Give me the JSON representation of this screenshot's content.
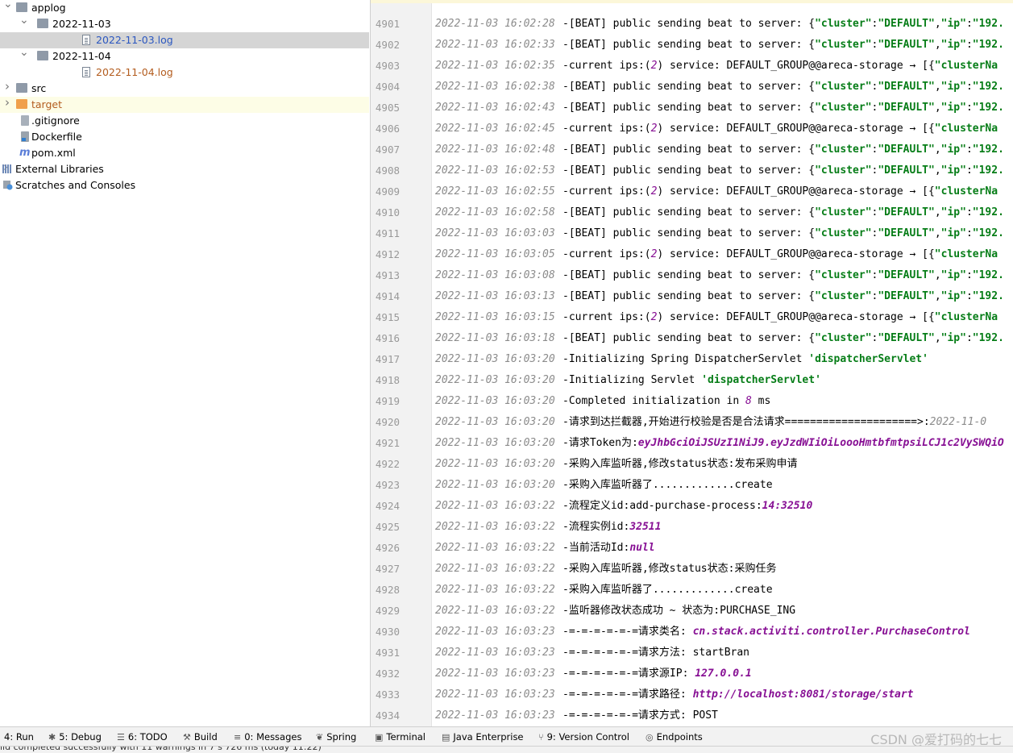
{
  "tree": [
    {
      "label": "applog",
      "icon": "folder-icon",
      "indent": 0,
      "arrow": "down",
      "style": ""
    },
    {
      "label": "2022-11-03",
      "icon": "folder-icon",
      "indent": 1,
      "arrow": "down",
      "style": ""
    },
    {
      "label": "2022-11-03.log",
      "icon": "log-file-icon",
      "indent": 2,
      "arrow": "",
      "style": "sel",
      "color": "#2b57c0"
    },
    {
      "label": "2022-11-04",
      "icon": "folder-icon",
      "indent": 1,
      "arrow": "down",
      "style": ""
    },
    {
      "label": "2022-11-04.log",
      "icon": "log-file-icon",
      "indent": 2,
      "arrow": "",
      "style": "",
      "color": "#b35c1e"
    },
    {
      "label": "src",
      "icon": "folder-icon",
      "indent": 0,
      "arrow": "right",
      "style": ""
    },
    {
      "label": "target",
      "icon": "folder-orange-icon",
      "indent": 0,
      "arrow": "right",
      "style": "hl",
      "color": "#b35c1e"
    },
    {
      "label": ".gitignore",
      "icon": "gitignore-file-icon",
      "indent": 0,
      "arrow": "",
      "style": ""
    },
    {
      "label": "Dockerfile",
      "icon": "docker-file-icon",
      "indent": 0,
      "arrow": "",
      "style": ""
    },
    {
      "label": "pom.xml",
      "icon": "maven-file-icon",
      "indent": 0,
      "arrow": "",
      "style": ""
    },
    {
      "label": "External Libraries",
      "icon": "libraries-icon",
      "indent": -1,
      "arrow": "right",
      "style": ""
    },
    {
      "label": "Scratches and Consoles",
      "icon": "scratches-icon",
      "indent": -1,
      "arrow": "",
      "style": ""
    }
  ],
  "log_lines": [
    {
      "n": "4901",
      "ts": "2022-11-03 16:02:28",
      "parts": [
        [
          "-",
          ""
        ],
        [
          "[BEAT] public sending beat to server: {",
          ""
        ],
        [
          "\"cluster\"",
          "s"
        ],
        [
          ":",
          ""
        ],
        [
          "\"DEFAULT\"",
          "s"
        ],
        [
          ",",
          ""
        ],
        [
          "\"ip\"",
          "s"
        ],
        [
          ":",
          ""
        ],
        [
          "\"192.",
          "s"
        ]
      ]
    },
    {
      "n": "4902",
      "ts": "2022-11-03 16:02:33",
      "parts": [
        [
          "-",
          ""
        ],
        [
          "[BEAT] public sending beat to server: {",
          ""
        ],
        [
          "\"cluster\"",
          "s"
        ],
        [
          ":",
          ""
        ],
        [
          "\"DEFAULT\"",
          "s"
        ],
        [
          ",",
          ""
        ],
        [
          "\"ip\"",
          "s"
        ],
        [
          ":",
          ""
        ],
        [
          "\"192.",
          "s"
        ]
      ]
    },
    {
      "n": "4903",
      "ts": "2022-11-03 16:02:35",
      "parts": [
        [
          "-current ips:(",
          ""
        ],
        [
          "2",
          "n"
        ],
        [
          ") service: DEFAULT_GROUP@@areca-storage → [{",
          ""
        ],
        [
          "\"clusterNa",
          "s"
        ]
      ]
    },
    {
      "n": "4904",
      "ts": "2022-11-03 16:02:38",
      "parts": [
        [
          "-",
          ""
        ],
        [
          "[BEAT] public sending beat to server: {",
          ""
        ],
        [
          "\"cluster\"",
          "s"
        ],
        [
          ":",
          ""
        ],
        [
          "\"DEFAULT\"",
          "s"
        ],
        [
          ",",
          ""
        ],
        [
          "\"ip\"",
          "s"
        ],
        [
          ":",
          ""
        ],
        [
          "\"192.",
          "s"
        ]
      ]
    },
    {
      "n": "4905",
      "ts": "2022-11-03 16:02:43",
      "parts": [
        [
          "-",
          ""
        ],
        [
          "[BEAT] public sending beat to server: {",
          ""
        ],
        [
          "\"cluster\"",
          "s"
        ],
        [
          ":",
          ""
        ],
        [
          "\"DEFAULT\"",
          "s"
        ],
        [
          ",",
          ""
        ],
        [
          "\"ip\"",
          "s"
        ],
        [
          ":",
          ""
        ],
        [
          "\"192.",
          "s"
        ]
      ]
    },
    {
      "n": "4906",
      "ts": "2022-11-03 16:02:45",
      "parts": [
        [
          "-current ips:(",
          ""
        ],
        [
          "2",
          "n"
        ],
        [
          ") service: DEFAULT_GROUP@@areca-storage → [{",
          ""
        ],
        [
          "\"clusterNa",
          "s"
        ]
      ]
    },
    {
      "n": "4907",
      "ts": "2022-11-03 16:02:48",
      "parts": [
        [
          "-",
          ""
        ],
        [
          "[BEAT] public sending beat to server: {",
          ""
        ],
        [
          "\"cluster\"",
          "s"
        ],
        [
          ":",
          ""
        ],
        [
          "\"DEFAULT\"",
          "s"
        ],
        [
          ",",
          ""
        ],
        [
          "\"ip\"",
          "s"
        ],
        [
          ":",
          ""
        ],
        [
          "\"192.",
          "s"
        ]
      ]
    },
    {
      "n": "4908",
      "ts": "2022-11-03 16:02:53",
      "parts": [
        [
          "-",
          ""
        ],
        [
          "[BEAT] public sending beat to server: {",
          ""
        ],
        [
          "\"cluster\"",
          "s"
        ],
        [
          ":",
          ""
        ],
        [
          "\"DEFAULT\"",
          "s"
        ],
        [
          ",",
          ""
        ],
        [
          "\"ip\"",
          "s"
        ],
        [
          ":",
          ""
        ],
        [
          "\"192.",
          "s"
        ]
      ]
    },
    {
      "n": "4909",
      "ts": "2022-11-03 16:02:55",
      "parts": [
        [
          "-current ips:(",
          ""
        ],
        [
          "2",
          "n"
        ],
        [
          ") service: DEFAULT_GROUP@@areca-storage → [{",
          ""
        ],
        [
          "\"clusterNa",
          "s"
        ]
      ]
    },
    {
      "n": "4910",
      "ts": "2022-11-03 16:02:58",
      "parts": [
        [
          "-",
          ""
        ],
        [
          "[BEAT] public sending beat to server: {",
          ""
        ],
        [
          "\"cluster\"",
          "s"
        ],
        [
          ":",
          ""
        ],
        [
          "\"DEFAULT\"",
          "s"
        ],
        [
          ",",
          ""
        ],
        [
          "\"ip\"",
          "s"
        ],
        [
          ":",
          ""
        ],
        [
          "\"192.",
          "s"
        ]
      ]
    },
    {
      "n": "4911",
      "ts": "2022-11-03 16:03:03",
      "parts": [
        [
          "-",
          ""
        ],
        [
          "[BEAT] public sending beat to server: {",
          ""
        ],
        [
          "\"cluster\"",
          "s"
        ],
        [
          ":",
          ""
        ],
        [
          "\"DEFAULT\"",
          "s"
        ],
        [
          ",",
          ""
        ],
        [
          "\"ip\"",
          "s"
        ],
        [
          ":",
          ""
        ],
        [
          "\"192.",
          "s"
        ]
      ]
    },
    {
      "n": "4912",
      "ts": "2022-11-03 16:03:05",
      "parts": [
        [
          "-current ips:(",
          ""
        ],
        [
          "2",
          "n"
        ],
        [
          ") service: DEFAULT_GROUP@@areca-storage → [{",
          ""
        ],
        [
          "\"clusterNa",
          "s"
        ]
      ]
    },
    {
      "n": "4913",
      "ts": "2022-11-03 16:03:08",
      "parts": [
        [
          "-",
          ""
        ],
        [
          "[BEAT] public sending beat to server: {",
          ""
        ],
        [
          "\"cluster\"",
          "s"
        ],
        [
          ":",
          ""
        ],
        [
          "\"DEFAULT\"",
          "s"
        ],
        [
          ",",
          ""
        ],
        [
          "\"ip\"",
          "s"
        ],
        [
          ":",
          ""
        ],
        [
          "\"192.",
          "s"
        ]
      ]
    },
    {
      "n": "4914",
      "ts": "2022-11-03 16:03:13",
      "parts": [
        [
          "-",
          ""
        ],
        [
          "[BEAT] public sending beat to server: {",
          ""
        ],
        [
          "\"cluster\"",
          "s"
        ],
        [
          ":",
          ""
        ],
        [
          "\"DEFAULT\"",
          "s"
        ],
        [
          ",",
          ""
        ],
        [
          "\"ip\"",
          "s"
        ],
        [
          ":",
          ""
        ],
        [
          "\"192.",
          "s"
        ]
      ]
    },
    {
      "n": "4915",
      "ts": "2022-11-03 16:03:15",
      "parts": [
        [
          "-current ips:(",
          ""
        ],
        [
          "2",
          "n"
        ],
        [
          ") service: DEFAULT_GROUP@@areca-storage → [{",
          ""
        ],
        [
          "\"clusterNa",
          "s"
        ]
      ]
    },
    {
      "n": "4916",
      "ts": "2022-11-03 16:03:18",
      "parts": [
        [
          "-",
          ""
        ],
        [
          "[BEAT] public sending beat to server: {",
          ""
        ],
        [
          "\"cluster\"",
          "s"
        ],
        [
          ":",
          ""
        ],
        [
          "\"DEFAULT\"",
          "s"
        ],
        [
          ",",
          ""
        ],
        [
          "\"ip\"",
          "s"
        ],
        [
          ":",
          ""
        ],
        [
          "\"192.",
          "s"
        ]
      ]
    },
    {
      "n": "4917",
      "ts": "2022-11-03 16:03:20",
      "parts": [
        [
          "-Initializing Spring DispatcherServlet ",
          ""
        ],
        [
          "'dispatcherServlet'",
          "s"
        ]
      ]
    },
    {
      "n": "4918",
      "ts": "2022-11-03 16:03:20",
      "parts": [
        [
          "-Initializing Servlet ",
          ""
        ],
        [
          "'dispatcherServlet'",
          "s"
        ]
      ]
    },
    {
      "n": "4919",
      "ts": "2022-11-03 16:03:20",
      "parts": [
        [
          "-Completed initialization in ",
          ""
        ],
        [
          "8",
          "n"
        ],
        [
          " ms",
          ""
        ]
      ]
    },
    {
      "n": "4920",
      "ts": "2022-11-03 16:03:20",
      "parts": [
        [
          "-请求到达拦截器,开始进行校验是否是合法请求=====================>:",
          ""
        ],
        [
          "2022-11-0",
          "g"
        ]
      ]
    },
    {
      "n": "4921",
      "ts": "2022-11-03 16:03:20",
      "parts": [
        [
          "-请求Token为:",
          ""
        ],
        [
          "eyJhbGciOiJSUzI1NiJ9.eyJzdWIiOiLoooHmtbfmtpsiLCJ1c2VySWQiO",
          "v"
        ]
      ]
    },
    {
      "n": "4922",
      "ts": "2022-11-03 16:03:20",
      "parts": [
        [
          "-采购入库监听器,修改status状态:发布采购申请",
          ""
        ]
      ]
    },
    {
      "n": "4923",
      "ts": "2022-11-03 16:03:20",
      "parts": [
        [
          "-采购入库监听器了.............create",
          ""
        ]
      ]
    },
    {
      "n": "4924",
      "ts": "2022-11-03 16:03:22",
      "parts": [
        [
          "-流程定义id:add-purchase-process:",
          ""
        ],
        [
          "14:32510",
          "v"
        ]
      ]
    },
    {
      "n": "4925",
      "ts": "2022-11-03 16:03:22",
      "parts": [
        [
          "-流程实例id:",
          ""
        ],
        [
          "32511",
          "v"
        ]
      ]
    },
    {
      "n": "4926",
      "ts": "2022-11-03 16:03:22",
      "parts": [
        [
          "-当前活动Id:",
          ""
        ],
        [
          "null",
          "v"
        ]
      ]
    },
    {
      "n": "4927",
      "ts": "2022-11-03 16:03:22",
      "parts": [
        [
          "-采购入库监听器,修改status状态:采购任务",
          ""
        ]
      ]
    },
    {
      "n": "4928",
      "ts": "2022-11-03 16:03:22",
      "parts": [
        [
          "-采购入库监听器了.............create",
          ""
        ]
      ]
    },
    {
      "n": "4929",
      "ts": "2022-11-03 16:03:22",
      "parts": [
        [
          "-监听器修改状态成功 ~ 状态为:PURCHASE_ING",
          ""
        ]
      ]
    },
    {
      "n": "4930",
      "ts": "2022-11-03 16:03:23",
      "parts": [
        [
          "-=-=-=-=-=-=请求类名: ",
          ""
        ],
        [
          "cn.stack.activiti.controller.PurchaseControl",
          "v"
        ]
      ]
    },
    {
      "n": "4931",
      "ts": "2022-11-03 16:03:23",
      "parts": [
        [
          "-=-=-=-=-=-=请求方法: startBran",
          ""
        ]
      ]
    },
    {
      "n": "4932",
      "ts": "2022-11-03 16:03:23",
      "parts": [
        [
          "-=-=-=-=-=-=请求源IP: ",
          ""
        ],
        [
          "127.0.0.1",
          "v"
        ]
      ]
    },
    {
      "n": "4933",
      "ts": "2022-11-03 16:03:23",
      "parts": [
        [
          "-=-=-=-=-=-=请求路径: ",
          ""
        ],
        [
          "http://localhost:8081/storage/start",
          "v"
        ]
      ]
    },
    {
      "n": "4934",
      "ts": "2022-11-03 16:03:23",
      "parts": [
        [
          "-=-=-=-=-=-=请求方式: POST",
          ""
        ]
      ]
    }
  ],
  "toolbar": [
    {
      "label": "4: Run",
      "icon": "run-icon",
      "glyph": "▶"
    },
    {
      "label": "5: Debug",
      "icon": "debug-icon",
      "glyph": "✱"
    },
    {
      "label": "6: TODO",
      "icon": "todo-icon",
      "glyph": "☰"
    },
    {
      "label": "Build",
      "icon": "build-icon",
      "glyph": "⚒"
    },
    {
      "label": "0: Messages",
      "icon": "messages-icon",
      "glyph": "≡"
    },
    {
      "label": "Spring",
      "icon": "spring-icon",
      "glyph": "❦"
    },
    {
      "label": "Terminal",
      "icon": "terminal-icon",
      "glyph": "▣"
    },
    {
      "label": "Java Enterprise",
      "icon": "java-enterprise-icon",
      "glyph": "▤"
    },
    {
      "label": "9: Version Control",
      "icon": "version-control-icon",
      "glyph": "⑂"
    },
    {
      "label": "Endpoints",
      "icon": "endpoints-icon",
      "glyph": "◎"
    }
  ],
  "watermark": "CSDN @爱打码的七七",
  "status_text": "ild completed successfully with 11 warnings in 7 s 726 ms (today 11:22)"
}
